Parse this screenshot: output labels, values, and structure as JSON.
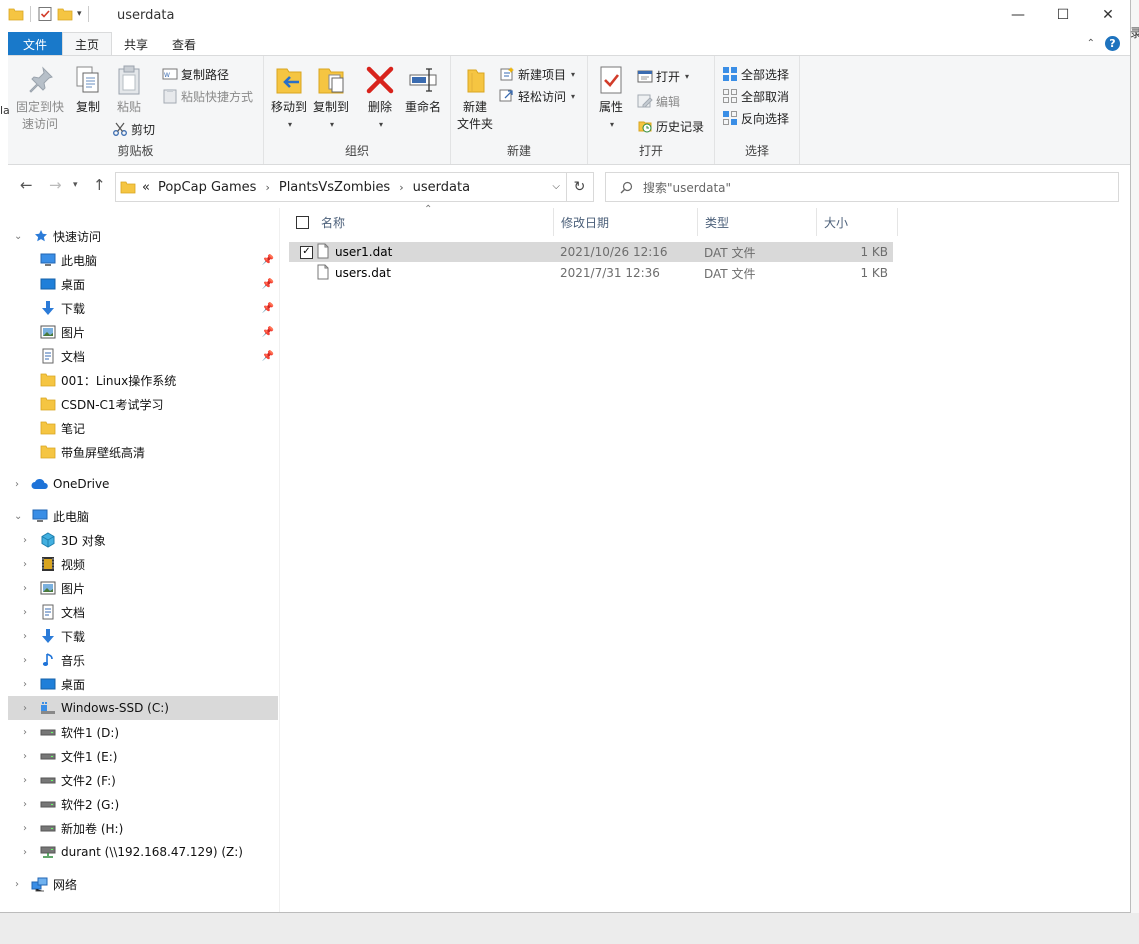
{
  "window": {
    "title": "userdata"
  },
  "tabs": [
    "文件",
    "主页",
    "共享",
    "查看"
  ],
  "ribbon": {
    "clipboard": {
      "pin_label_1": "固定到快",
      "pin_label_2": "速访问",
      "copy": "复制",
      "paste": "粘贴",
      "copy_path": "复制路径",
      "paste_shortcut": "粘贴快捷方式",
      "cut": "剪切",
      "group": "剪贴板"
    },
    "organize": {
      "move_to": "移动到",
      "copy_to": "复制到",
      "delete": "删除",
      "rename": "重命名",
      "group": "组织"
    },
    "new": {
      "new_folder_1": "新建",
      "new_folder_2": "文件夹",
      "new_item": "新建项目",
      "easy_access": "轻松访问",
      "group": "新建"
    },
    "open": {
      "properties": "属性",
      "open": "打开",
      "edit": "编辑",
      "history": "历史记录",
      "group": "打开"
    },
    "select": {
      "select_all": "全部选择",
      "select_none": "全部取消",
      "invert": "反向选择",
      "group": "选择"
    }
  },
  "address": {
    "overflow": "«",
    "crumbs": [
      "PopCap Games",
      "PlantsVsZombies",
      "userdata"
    ],
    "search_placeholder": "搜索\"userdata\""
  },
  "nav": {
    "quick_access": "快速访问",
    "quick_items": [
      "此电脑",
      "桌面",
      "下载",
      "图片",
      "文档",
      "001：Linux操作系统",
      "CSDN-C1考试学习",
      "笔记",
      "带鱼屏壁纸高清"
    ],
    "onedrive": "OneDrive",
    "this_pc": "此电脑",
    "pc_items": [
      "3D 对象",
      "视频",
      "图片",
      "文档",
      "下载",
      "音乐",
      "桌面",
      "Windows-SSD (C:)",
      "软件1 (D:)",
      "文件1 (E:)",
      "文件2 (F:)",
      "软件2 (G:)",
      "新加卷 (H:)",
      "durant (\\\\192.168.47.129) (Z:)"
    ],
    "network": "网络"
  },
  "list": {
    "columns": [
      "名称",
      "修改日期",
      "类型",
      "大小"
    ],
    "files": [
      {
        "name": "user1.dat",
        "modified": "2021/10/26 12:16",
        "type": "DAT 文件",
        "size": "1 KB",
        "selected": true
      },
      {
        "name": "users.dat",
        "modified": "2021/7/31 12:36",
        "type": "DAT 文件",
        "size": "1 KB",
        "selected": false
      }
    ]
  },
  "background": {
    "left_char": "la",
    "right_char": "录"
  },
  "colors": {
    "file_tab": "#1979ca",
    "selection": "#d9d9d9",
    "folder": "#f5c542"
  }
}
